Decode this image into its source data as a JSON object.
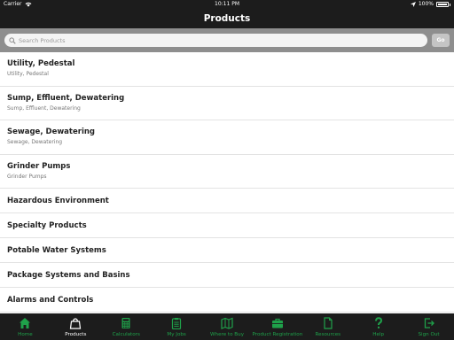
{
  "status_bar": {
    "carrier": "Carrier",
    "time": "10:11 PM",
    "battery": "100%"
  },
  "nav": {
    "title": "Products"
  },
  "search": {
    "placeholder": "Search Products",
    "value": "",
    "go_label": "Go"
  },
  "products": [
    {
      "title": "Utility, Pedestal",
      "subtitle": "Utility, Pedestal"
    },
    {
      "title": "Sump, Effluent, Dewatering",
      "subtitle": "Sump, Effluent, Dewatering"
    },
    {
      "title": "Sewage, Dewatering",
      "subtitle": "Sewage, Dewatering"
    },
    {
      "title": "Grinder Pumps",
      "subtitle": "Grinder Pumps"
    },
    {
      "title": "Hazardous Environment"
    },
    {
      "title": "Specialty Products"
    },
    {
      "title": "Potable Water Systems"
    },
    {
      "title": "Package Systems and Basins"
    },
    {
      "title": "Alarms and Controls"
    }
  ],
  "tabs": [
    {
      "label": "Home",
      "icon": "home-icon"
    },
    {
      "label": "Products",
      "icon": "shopping-bag-icon",
      "active": true
    },
    {
      "label": "Calculators",
      "icon": "calculator-icon"
    },
    {
      "label": "My Jobs",
      "icon": "clipboard-icon"
    },
    {
      "label": "Where to Buy",
      "icon": "map-icon"
    },
    {
      "label": "Product Registration",
      "icon": "briefcase-icon"
    },
    {
      "label": "Resources",
      "icon": "document-icon"
    },
    {
      "label": "Help",
      "icon": "question-mark-icon"
    },
    {
      "label": "Sign Out",
      "icon": "sign-out-icon"
    }
  ],
  "colors": {
    "accent_green": "#1fa14a",
    "bar_dark": "#1c1c1c",
    "search_bar_gray": "#8e8e8e"
  }
}
